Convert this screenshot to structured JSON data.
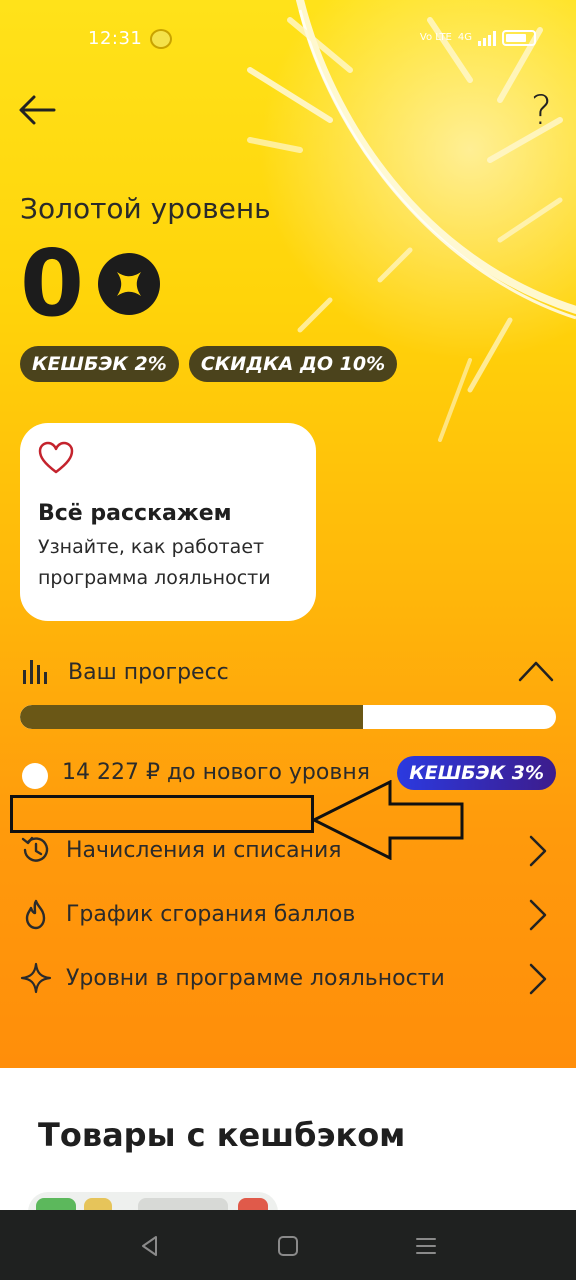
{
  "status_bar": {
    "time": "12:31",
    "network": "Vo LTE",
    "network_gen": "4G"
  },
  "header": {
    "help_label": "?"
  },
  "level": {
    "title": "Золотой уровень",
    "points": "0",
    "chips": [
      "КЕШБЭК 2%",
      "СКИДКА ДО 10%"
    ]
  },
  "info_card": {
    "title": "Всё расскажем",
    "text": "Узнайте, как работает программа лояльности"
  },
  "progress": {
    "label": "Ваш прогресс",
    "fraction": 0.64,
    "remaining_text": "14 227 ₽ до нового уровня",
    "next_badge": "КЕШБЭК 3%"
  },
  "menu": {
    "items": [
      {
        "label": "Начисления и списания",
        "icon": "history-icon"
      },
      {
        "label": "График сгорания баллов",
        "icon": "flame-icon"
      },
      {
        "label": "Уровни в программе лояльности",
        "icon": "sparkle-icon"
      }
    ]
  },
  "products": {
    "title": "Товары с кешбэком"
  },
  "colors": {
    "gradient_top": "#ffe21a",
    "gradient_bottom": "#ff8e0a",
    "progress_fill": "#6a5716",
    "badge_gradient_start": "#2b3ae0",
    "badge_gradient_end": "#3d1c8c",
    "chip_bg": "#3c371e"
  }
}
